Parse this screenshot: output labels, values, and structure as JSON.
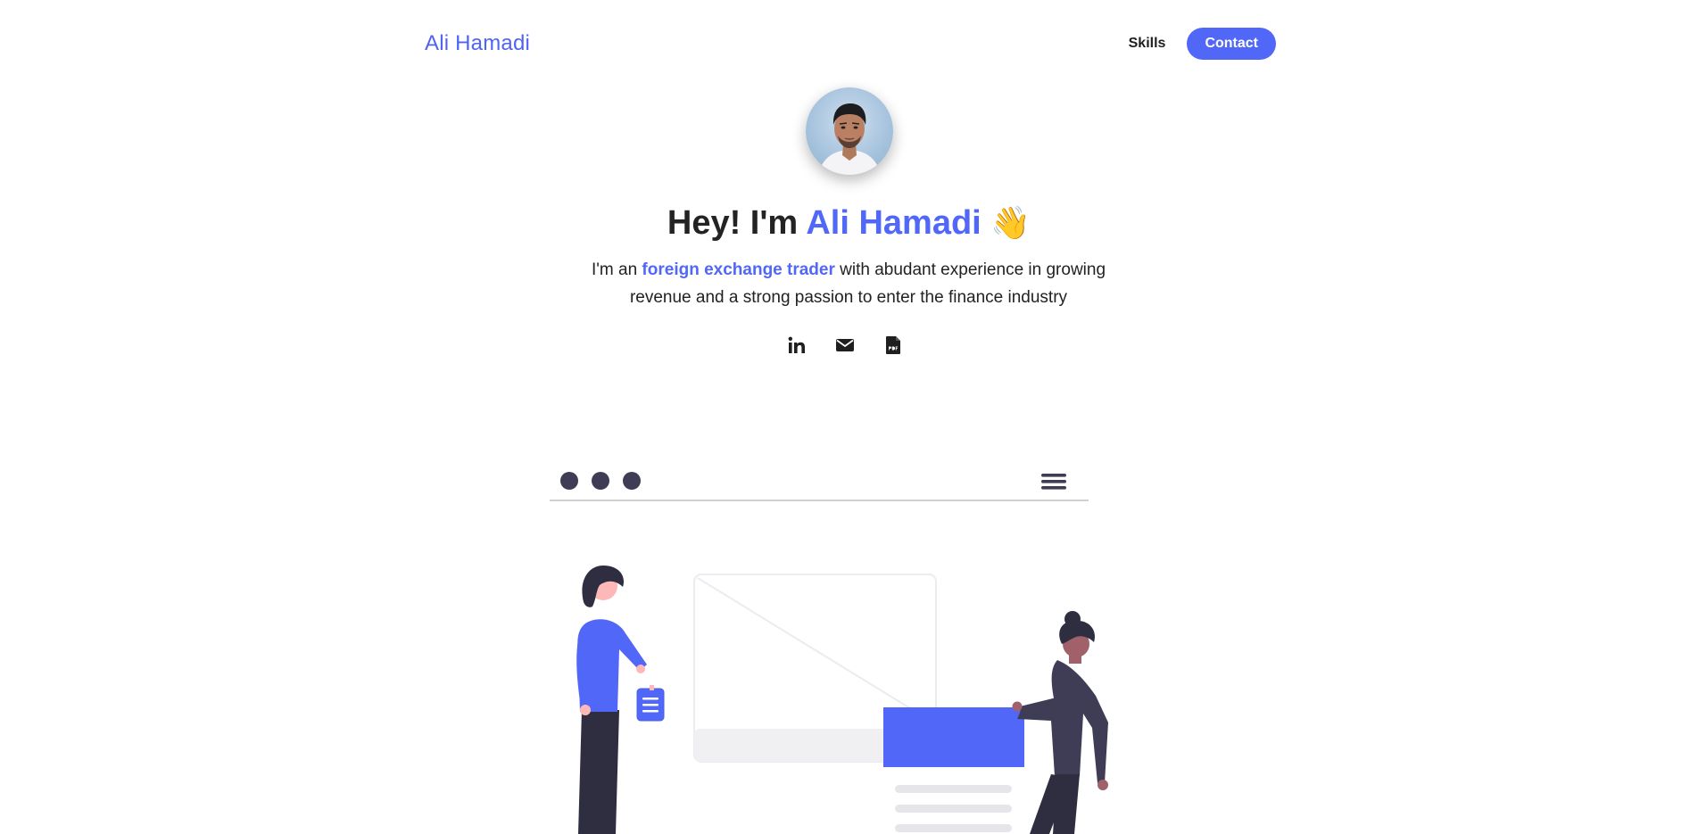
{
  "header": {
    "brand": "Ali Hamadi",
    "nav": {
      "skills_label": "Skills",
      "contact_label": "Contact"
    }
  },
  "hero": {
    "greeting": "Hey! I'm",
    "name": "Ali Hamadi",
    "wave_emoji": "👋",
    "intro_prefix": "I'm an",
    "intro_highlight": "foreign exchange trader",
    "intro_suffix": "with abudant experience in growing revenue and a strong passion to enter the finance industry",
    "socials": [
      {
        "icon": "linkedin-icon"
      },
      {
        "icon": "envelope-icon"
      },
      {
        "icon": "pdf-file-icon"
      }
    ]
  },
  "colors": {
    "accent": "#5167f7",
    "dark": "#3f3d56",
    "text": "#222222"
  }
}
